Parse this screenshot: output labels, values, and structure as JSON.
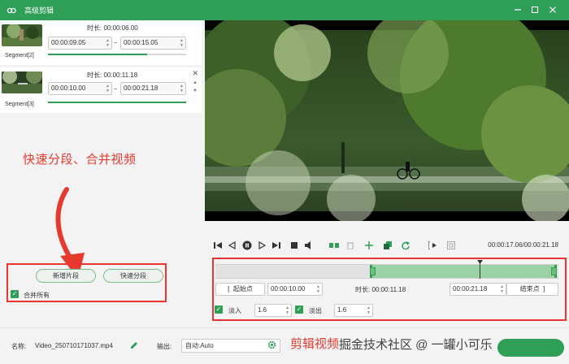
{
  "window": {
    "title": "高级剪辑"
  },
  "segments": [
    {
      "name": "Segment[2]",
      "duration_label": "时长:",
      "duration": "00:00:06.00",
      "start": "00:00:09.05",
      "end": "00:00:15.05",
      "progress": 0.72
    },
    {
      "name": "Segment[3]",
      "duration_label": "时长:",
      "duration": "00:00:11.18",
      "start": "00:00:10.00",
      "end": "00:00:21.18",
      "progress": 1.0
    }
  ],
  "annotations": {
    "left": "快速分段、合并视频",
    "right": "剪辑视频",
    "watermark": "掘金技术社区 @ 一罐小可乐"
  },
  "left_actions": {
    "new_segment": "新增片段",
    "quick_split": "快速分段",
    "merge_all": "合并所有",
    "merge_all_checked": true
  },
  "player": {
    "current_time": "00:00:17.06",
    "total_time": "00:00:21.18",
    "time_display": "00:00:17.06/00:00:21.18"
  },
  "timeline": {
    "selection_start_fraction": 0.45,
    "selection_end_fraction": 1.0,
    "playhead_fraction": 0.77
  },
  "trim": {
    "start_label": "起始点",
    "start_value": "00:00:10.00",
    "duration_label": "时长:",
    "duration_value": "00:00:11.18",
    "end_value": "00:00:21.18",
    "end_label": "结束点",
    "fade_in_label": "淡入",
    "fade_in_value": "1.6",
    "fade_in_checked": true,
    "fade_out_label": "淡出",
    "fade_out_value": "1.6",
    "fade_out_checked": true
  },
  "bottom": {
    "name_label": "名称:",
    "file_name": "Video_250710171037.mp4",
    "output_label": "输出:",
    "output_value": "自动:Auto"
  },
  "colors": {
    "accent": "#2f9e57",
    "annotation": "#e63a2e",
    "selection": "#9bd3a6"
  }
}
